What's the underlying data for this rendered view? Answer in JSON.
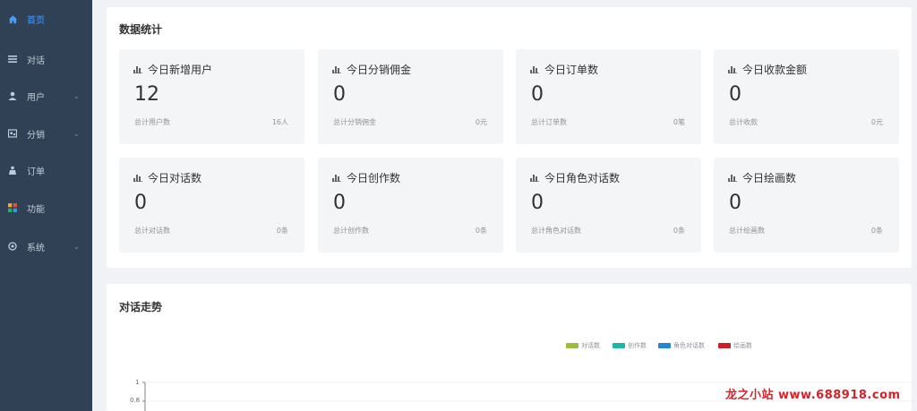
{
  "sidebar": {
    "items": [
      {
        "label": "首页",
        "icon": "home-icon",
        "active": true
      },
      {
        "label": "对话",
        "icon": "list-icon"
      },
      {
        "label": "用户",
        "icon": "user-icon",
        "expandable": true
      },
      {
        "label": "分销",
        "icon": "share-icon",
        "expandable": true
      },
      {
        "label": "订单",
        "icon": "order-icon"
      },
      {
        "label": "功能",
        "icon": "grid-icon"
      },
      {
        "label": "系统",
        "icon": "settings-icon",
        "expandable": true
      }
    ]
  },
  "stats": {
    "title": "数据统计",
    "cards": [
      {
        "title": "今日新增用户",
        "value": "12",
        "footer_label": "总计用户数",
        "footer_value": "16人"
      },
      {
        "title": "今日分销佣金",
        "value": "0",
        "footer_label": "总计分销佣金",
        "footer_value": "0元"
      },
      {
        "title": "今日订单数",
        "value": "0",
        "footer_label": "总计订单数",
        "footer_value": "0笔"
      },
      {
        "title": "今日收款金额",
        "value": "0",
        "footer_label": "总计收款",
        "footer_value": "0元"
      },
      {
        "title": "今日对话数",
        "value": "0",
        "footer_label": "总计对话数",
        "footer_value": "0条"
      },
      {
        "title": "今日创作数",
        "value": "0",
        "footer_label": "总计创作数",
        "footer_value": "0条"
      },
      {
        "title": "今日角色对话数",
        "value": "0",
        "footer_label": "总计角色对话数",
        "footer_value": "0条"
      },
      {
        "title": "今日绘画数",
        "value": "0",
        "footer_label": "总计绘画数",
        "footer_value": "0条"
      }
    ]
  },
  "trend": {
    "title": "对话走势",
    "legend": [
      {
        "name": "对话数",
        "color": "#9bbd3c"
      },
      {
        "name": "创作数",
        "color": "#1cb5a6"
      },
      {
        "name": "角色对话数",
        "color": "#1e88d6"
      },
      {
        "name": "绘画数",
        "color": "#c9202a"
      }
    ],
    "y_ticks": [
      "1",
      "0.8"
    ]
  },
  "watermark": "龙之小站 www.688918.com",
  "colors": {
    "sidebar_bg": "#304156",
    "active": "#409eff",
    "card_bg": "#f4f5f7"
  }
}
